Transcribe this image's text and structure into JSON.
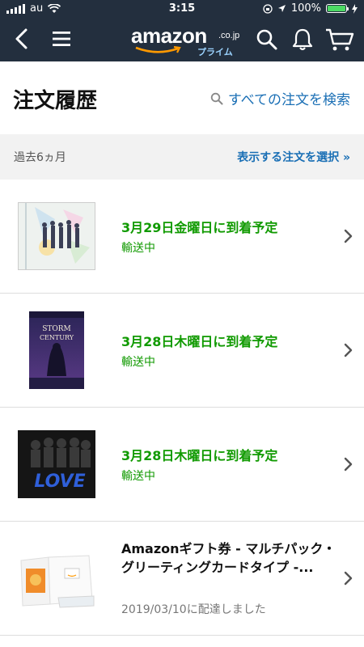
{
  "status": {
    "carrier": "au",
    "time": "3:15",
    "battery": "100%",
    "battery_level": 1.0
  },
  "nav": {
    "logo_word": "amazon",
    "logo_tld": ".co.jp",
    "logo_prime": "プライム"
  },
  "header": {
    "title": "注文履歴",
    "search_link": "すべての注文を検索"
  },
  "filter": {
    "period": "過去6ヵ月",
    "select_link": "表示する注文を選択 »"
  },
  "orders": [
    {
      "title": "3月29日金曜日に到着予定",
      "status": "輸送中"
    },
    {
      "title": "3月28日木曜日に到着予定",
      "status": "輸送中"
    },
    {
      "title": "3月28日木曜日に到着予定",
      "status": "輸送中"
    },
    {
      "title": "Amazonギフト券 - マルチパック・グリーティングカードタイプ -...",
      "status": "2019/03/10に配達しました"
    }
  ],
  "thumbs": {
    "storm_title": "STORM",
    "storm_sub": "CENTURY",
    "love": "LOVE"
  },
  "colors": {
    "navbar": "#232f3e",
    "link": "#1a6fb5",
    "shipping_green": "#109a00"
  }
}
